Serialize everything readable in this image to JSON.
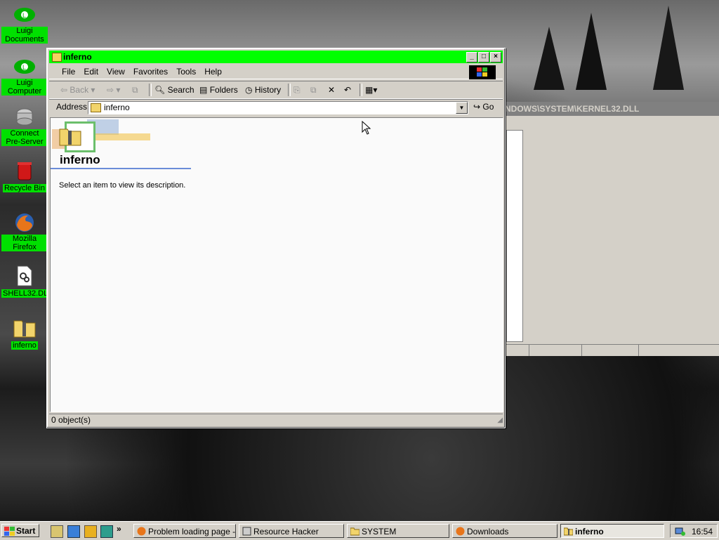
{
  "desktop": {
    "icons": [
      {
        "label": "Luigi Documents",
        "icon": "luigi-cap-icon"
      },
      {
        "label": "Luigi Computer",
        "icon": "luigi-cap-icon"
      },
      {
        "label": "Connect Pre-Server",
        "icon": "server-icon"
      },
      {
        "label": "Recycle Bin",
        "icon": "recycle-bin-icon"
      },
      {
        "label": "Mozilla Firefox",
        "icon": "firefox-icon"
      },
      {
        "label": "SHELL32.DLL",
        "icon": "dll-file-icon"
      },
      {
        "label": "inferno",
        "icon": "zip-folder-icon"
      }
    ]
  },
  "back_window": {
    "title": "NDOWS\\SYSTEM\\KERNEL32.DLL"
  },
  "window": {
    "title": "inferno",
    "menu": [
      "File",
      "Edit",
      "View",
      "Favorites",
      "Tools",
      "Help"
    ],
    "toolbar": {
      "back": "Back",
      "search": "Search",
      "folders": "Folders",
      "history": "History"
    },
    "address": {
      "label": "Address",
      "value": "inferno",
      "go": "Go"
    },
    "folder_title": "inferno",
    "description": "Select an item to view its description.",
    "status": "0 object(s)"
  },
  "taskbar": {
    "start": "Start",
    "tasks": [
      {
        "label": "Problem loading page - ...",
        "icon": "firefox-icon",
        "active": false
      },
      {
        "label": "Resource Hacker",
        "icon": "resource-hacker-icon",
        "active": false
      },
      {
        "label": "SYSTEM",
        "icon": "folder-icon",
        "active": false
      },
      {
        "label": "Downloads",
        "icon": "firefox-icon",
        "active": false
      },
      {
        "label": "inferno",
        "icon": "zip-folder-icon",
        "active": true
      }
    ],
    "clock": "16:54"
  },
  "colors": {
    "title_bar": "#00ff00",
    "desktop_label_bg": "#00e000",
    "face": "#d4d0c8"
  }
}
